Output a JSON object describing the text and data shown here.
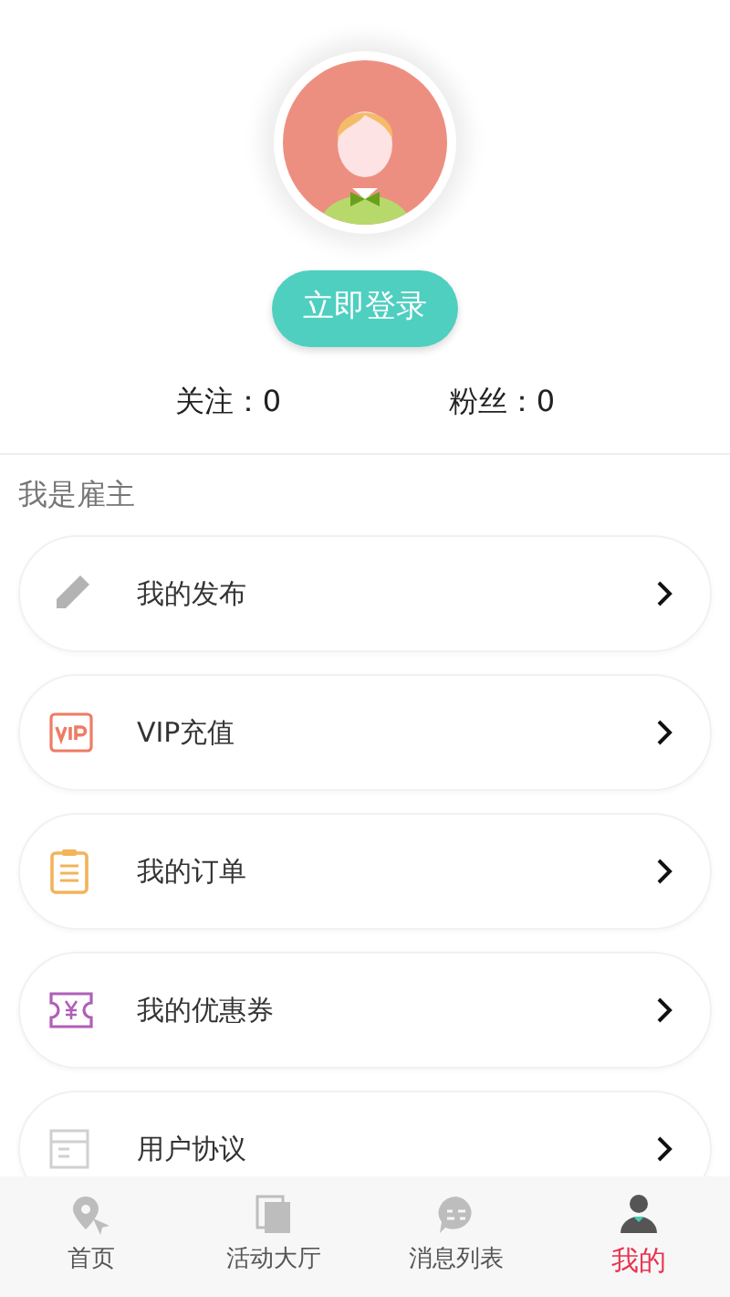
{
  "profile": {
    "login_button": "立即登录",
    "stats": [
      {
        "label": "关注：0"
      },
      {
        "label": "粉丝：0"
      }
    ]
  },
  "section_title": "我是雇主",
  "menu": [
    {
      "kind": "pencil",
      "label": "我的发布"
    },
    {
      "kind": "vip",
      "label": "VIP充值"
    },
    {
      "kind": "order",
      "label": "我的订单"
    },
    {
      "kind": "coupon",
      "label": "我的优惠券"
    },
    {
      "kind": "agreement",
      "label": "用户协议"
    }
  ],
  "tab_bar": [
    {
      "kind": "home",
      "label": "首页",
      "selected": false
    },
    {
      "kind": "hall",
      "label": "活动大厅",
      "selected": false
    },
    {
      "kind": "message",
      "label": "消息列表",
      "selected": false
    },
    {
      "kind": "profile",
      "label": "我的",
      "selected": true
    }
  ]
}
